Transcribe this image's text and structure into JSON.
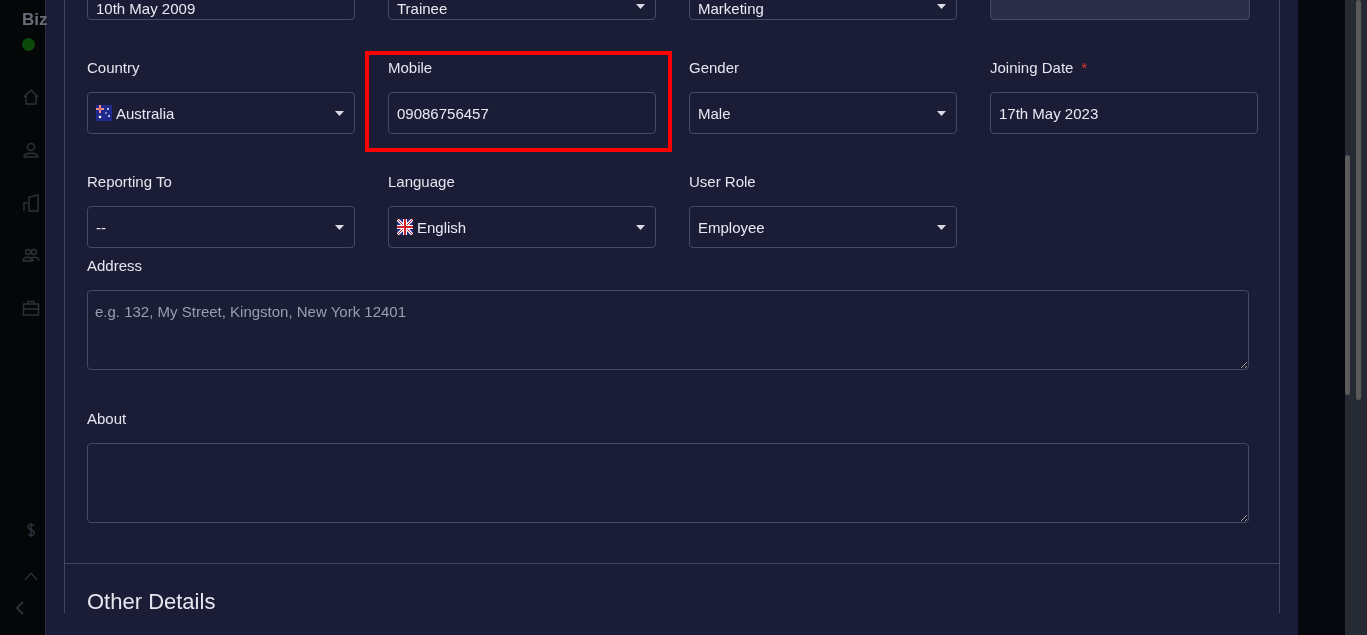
{
  "sidebar": {
    "brand": "Biz"
  },
  "top_fields": [
    {
      "kind": "input",
      "value": "10th May 2009",
      "disabled": false
    },
    {
      "kind": "select",
      "value": "Trainee",
      "disabled": false
    },
    {
      "kind": "select",
      "value": "Marketing",
      "disabled": false
    },
    {
      "kind": "input",
      "disabled": true
    }
  ],
  "fields": [
    {
      "label": "Country",
      "kind": "country",
      "value": "Australia",
      "highlighted": false
    },
    {
      "label": "Mobile",
      "kind": "input",
      "value": "09086756457",
      "highlighted": true
    },
    {
      "label": "Gender",
      "kind": "select",
      "value": "Male",
      "highlighted": false
    },
    {
      "label": "Joining Date",
      "kind": "input",
      "value": "17th May 2023",
      "required_mark": "*",
      "highlighted": false
    },
    {
      "label": "Reporting To",
      "kind": "select",
      "value": "--",
      "highlighted": false
    },
    {
      "label": "Language",
      "kind": "language",
      "value": "English",
      "highlighted": false
    },
    {
      "label": "User Role",
      "kind": "select",
      "value": "Employee",
      "highlighted": false
    }
  ],
  "textareas": [
    {
      "label": "Address",
      "placeholder": "e.g. 132, My Street, Kingston, New York 12401"
    },
    {
      "label": "About"
    }
  ],
  "section_title": "Other Details"
}
